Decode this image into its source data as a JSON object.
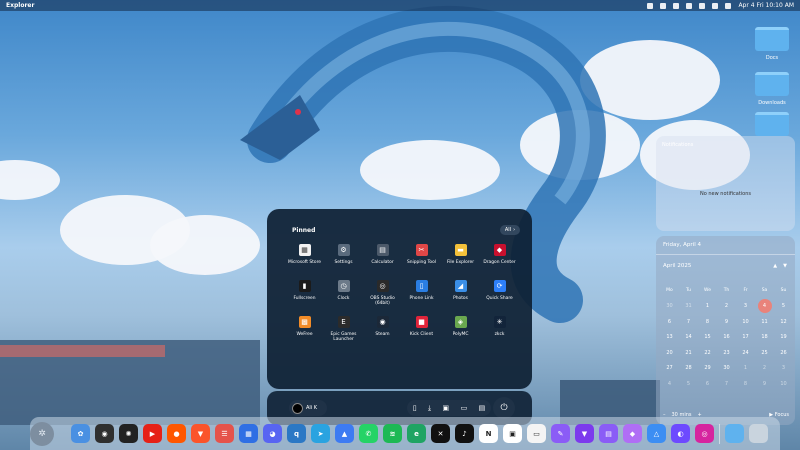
{
  "topbar": {
    "app_name": "Explorer",
    "datetime": "Apr 4 Fri 10:10 AM"
  },
  "desktop": {
    "icons": [
      {
        "label": "Docs",
        "icon": "folder-icon"
      },
      {
        "label": "Downloads",
        "icon": "folder-icon"
      },
      {
        "label": "",
        "icon": "folder-icon"
      }
    ]
  },
  "start_menu": {
    "pinned_title": "Pinned",
    "all_label": "All",
    "apps": [
      {
        "label": "Microsoft Store",
        "icon": "store-icon",
        "color": "#f2f2f2",
        "glyph": "▦"
      },
      {
        "label": "Settings",
        "icon": "gear-icon",
        "color": "#5a6b7d",
        "glyph": "⚙"
      },
      {
        "label": "Calculator",
        "icon": "calculator-icon",
        "color": "#4c5a6a",
        "glyph": "▤"
      },
      {
        "label": "Snipping Tool",
        "icon": "scissors-icon",
        "color": "#e04747",
        "glyph": "✂"
      },
      {
        "label": "File Explorer",
        "icon": "folder-icon",
        "color": "#f3c13a",
        "glyph": "▬"
      },
      {
        "label": "Dragon Center",
        "icon": "dragon-icon",
        "color": "#c8102e",
        "glyph": "◆"
      },
      {
        "label": "Fullscreen",
        "icon": "bars-icon",
        "color": "#1b1b1b",
        "glyph": "▮"
      },
      {
        "label": "Clock",
        "icon": "clock-icon",
        "color": "#6c7a89",
        "glyph": "◷"
      },
      {
        "label": "OBS Studio (64bit)",
        "icon": "obs-icon",
        "color": "#2a2a2a",
        "glyph": "◎"
      },
      {
        "label": "Phone Link",
        "icon": "phone-icon",
        "color": "#2a7de1",
        "glyph": "▯"
      },
      {
        "label": "Photos",
        "icon": "photos-icon",
        "color": "#3a8ee6",
        "glyph": "◢"
      },
      {
        "label": "Quick Share",
        "icon": "share-icon",
        "color": "#2d7ff9",
        "glyph": "⟳"
      },
      {
        "label": "WeFree",
        "icon": "wefree-icon",
        "color": "#f28c28",
        "glyph": "▩"
      },
      {
        "label": "Epic Games Launcher",
        "icon": "epic-icon",
        "color": "#2b2b2b",
        "glyph": "E"
      },
      {
        "label": "Steam",
        "icon": "steam-icon",
        "color": "#1b2838",
        "glyph": "◉"
      },
      {
        "label": "Kick Client",
        "icon": "kick-icon",
        "color": "#e0243a",
        "glyph": "■"
      },
      {
        "label": "PolyMC",
        "icon": "polymc-icon",
        "color": "#6aa84f",
        "glyph": "◈"
      },
      {
        "label": "zkck",
        "icon": "zkck-icon",
        "color": "#12243a",
        "glyph": "✳"
      }
    ]
  },
  "start_bottom": {
    "user_label": "Ali K",
    "quick_icons": [
      "document-icon",
      "download-icon",
      "image-icon",
      "folder-icon",
      "video-icon"
    ],
    "power_icon": "power-icon"
  },
  "notifications": {
    "title": "Notifications",
    "empty_text": "No new notifications"
  },
  "calendar": {
    "day_header": "Friday, April 4",
    "month_label": "April 2025",
    "weekdays": [
      "Mo",
      "Tu",
      "We",
      "Th",
      "Fr",
      "Sa",
      "Su"
    ],
    "weeks": [
      [
        "30",
        "31",
        "1",
        "2",
        "3",
        "4",
        "5"
      ],
      [
        "6",
        "7",
        "8",
        "9",
        "10",
        "11",
        "12"
      ],
      [
        "13",
        "14",
        "15",
        "16",
        "17",
        "18",
        "19"
      ],
      [
        "20",
        "21",
        "22",
        "23",
        "24",
        "25",
        "26"
      ],
      [
        "27",
        "28",
        "29",
        "30",
        "1",
        "2",
        "3"
      ],
      [
        "4",
        "5",
        "6",
        "7",
        "8",
        "9",
        "10"
      ]
    ],
    "today": "4",
    "focus_minutes": "30 mins",
    "focus_label": "Focus"
  },
  "dock": {
    "apps": [
      {
        "name": "photos",
        "color": "#4a90e2",
        "glyph": "✿"
      },
      {
        "name": "chrome",
        "color": "#2f2f2f",
        "glyph": "◉"
      },
      {
        "name": "chatgpt",
        "color": "#222222",
        "glyph": "✺"
      },
      {
        "name": "youtube",
        "color": "#e62117",
        "glyph": "▶"
      },
      {
        "name": "reddit",
        "color": "#ff5700",
        "glyph": "●"
      },
      {
        "name": "brave",
        "color": "#fb542b",
        "glyph": "▼"
      },
      {
        "name": "todo",
        "color": "#e5534b",
        "glyph": "☰"
      },
      {
        "name": "calendar",
        "color": "#2f6fe4",
        "glyph": "▦"
      },
      {
        "name": "discord",
        "color": "#5865f2",
        "glyph": "◕"
      },
      {
        "name": "qbittorrent",
        "color": "#2b78c5",
        "glyph": "q"
      },
      {
        "name": "telegram",
        "color": "#2aa3e0",
        "glyph": "➤"
      },
      {
        "name": "arc",
        "color": "#3d7bf2",
        "glyph": "▲"
      },
      {
        "name": "whatsapp",
        "color": "#25d366",
        "glyph": "✆"
      },
      {
        "name": "spotify",
        "color": "#1db954",
        "glyph": "≋"
      },
      {
        "name": "edge",
        "color": "#1fa463",
        "glyph": "e"
      },
      {
        "name": "capcut",
        "color": "#111111",
        "glyph": "✕"
      },
      {
        "name": "tiktok",
        "color": "#111111",
        "glyph": "♪"
      },
      {
        "name": "notion",
        "color": "#ffffff",
        "glyph": "N"
      },
      {
        "name": "topaz",
        "color": "#ffffff",
        "glyph": "▣"
      },
      {
        "name": "notes",
        "color": "#f4f4f4",
        "glyph": "▭"
      },
      {
        "name": "pen",
        "color": "#8b5cf6",
        "glyph": "✎"
      },
      {
        "name": "vpn",
        "color": "#7c3aed",
        "glyph": "▼"
      },
      {
        "name": "files",
        "color": "#8a5cf6",
        "glyph": "▤"
      },
      {
        "name": "shortcuts",
        "color": "#b06ef5",
        "glyph": "◆"
      },
      {
        "name": "drive",
        "color": "#3c8ef3",
        "glyph": "△"
      },
      {
        "name": "proton",
        "color": "#6d4aff",
        "glyph": "◐"
      },
      {
        "name": "instagram",
        "color": "#d6249f",
        "glyph": "◎"
      }
    ],
    "trash": {
      "name": "folder-downloads",
      "color": "#5fb2ee"
    }
  }
}
